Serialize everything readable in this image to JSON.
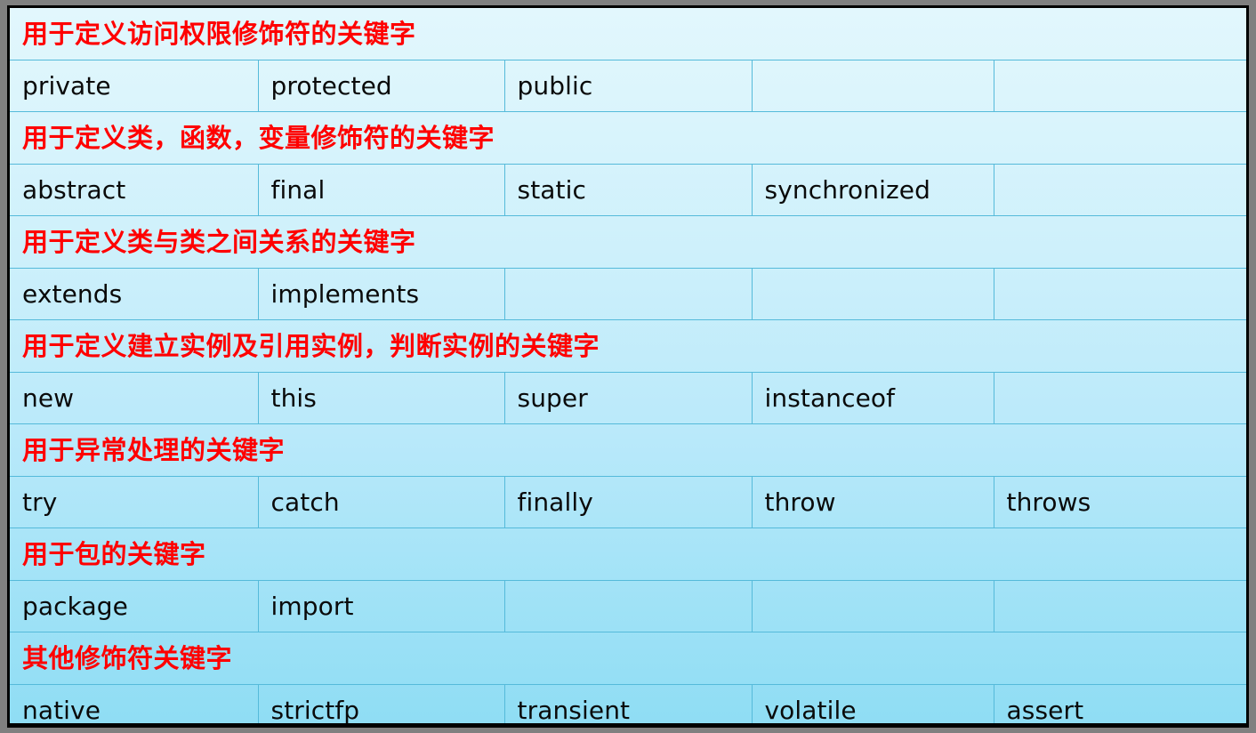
{
  "slide": {
    "background_color": "#808080",
    "frame_color": "#000000",
    "table_border_color": "#55bada",
    "category_text_color": "#ff0000",
    "keyword_text_color": "#0a0a0a",
    "table_fill_top": "#e2f7fd",
    "table_fill_bottom": "#8fddf4"
  },
  "table": {
    "column_count": 5,
    "sections": [
      {
        "category": "用于定义访问权限修饰符的关键字",
        "keywords": [
          "private",
          "protected",
          "public",
          "",
          ""
        ]
      },
      {
        "category": "用于定义类，函数，变量修饰符的关键字",
        "keywords": [
          "abstract",
          "final",
          "static",
          "synchronized",
          ""
        ]
      },
      {
        "category": "用于定义类与类之间关系的关键字",
        "keywords": [
          "extends",
          "implements",
          "",
          "",
          ""
        ]
      },
      {
        "category": "用于定义建立实例及引用实例，判断实例的关键字",
        "keywords": [
          "new",
          "this",
          "super",
          "instanceof",
          ""
        ]
      },
      {
        "category": "用于异常处理的关键字",
        "keywords": [
          "try",
          "catch",
          "finally",
          "throw",
          "throws"
        ]
      },
      {
        "category": "用于包的关键字",
        "keywords": [
          "package",
          "import",
          "",
          "",
          ""
        ]
      },
      {
        "category": "其他修饰符关键字",
        "keywords": [
          "native",
          "strictfp",
          "transient",
          "volatile",
          "assert"
        ]
      }
    ]
  }
}
